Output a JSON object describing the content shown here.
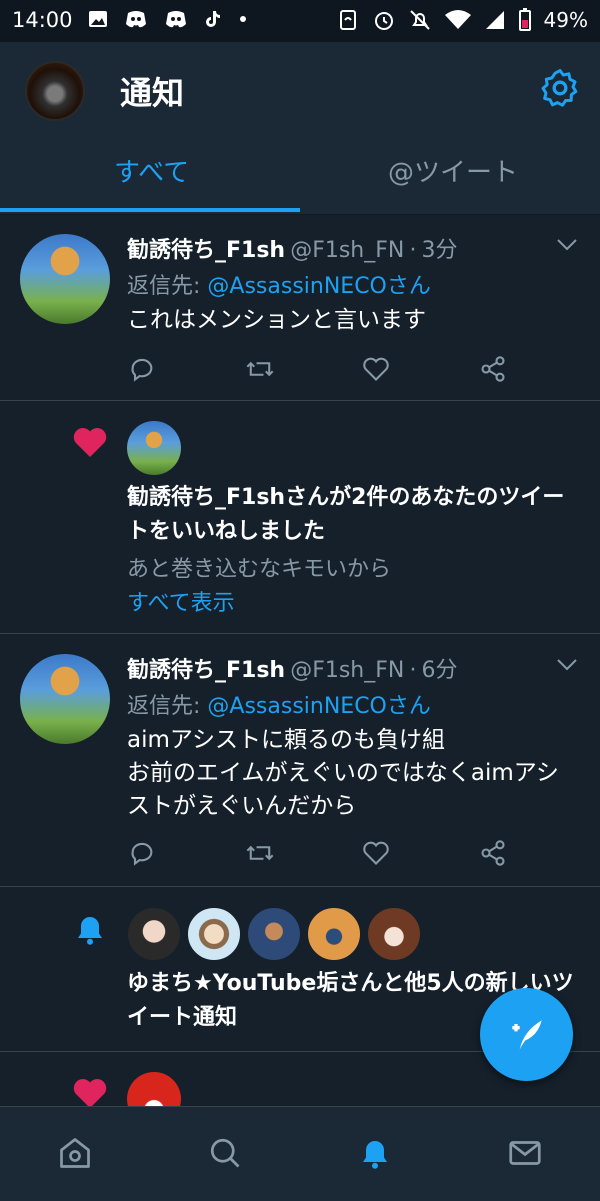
{
  "status_bar": {
    "time": "14:00",
    "battery": "49%",
    "left_icons": [
      "image-icon",
      "discord-icon",
      "discord-icon",
      "tiktok-icon",
      "dot-icon"
    ],
    "right_icons": [
      "nfc-icon",
      "alarm-icon",
      "mute-icon",
      "wifi-icon",
      "signal-icon",
      "battery-icon"
    ]
  },
  "header": {
    "title": "通知",
    "settings_icon": "gear-icon"
  },
  "tabs": [
    {
      "label": "すべて",
      "active": true
    },
    {
      "label": "@ツイート",
      "active": false
    }
  ],
  "feed": {
    "tweet1": {
      "display_name": "勧誘待ち_F1sh",
      "handle": "@F1sh_FN",
      "sep": "·",
      "time": "3分",
      "reply_label": "返信先: ",
      "reply_to": "@AssassinNECOさん",
      "text": "これはメンションと言います"
    },
    "like_notification": {
      "text": "勧誘待ち_F1shさんが2件のあなたのツイートをいいねしました",
      "preview": "あと巻き込むなキモいから",
      "show_all": "すべて表示"
    },
    "tweet2": {
      "display_name": "勧誘待ち_F1sh",
      "handle": "@F1sh_FN",
      "sep": "·",
      "time": "6分",
      "reply_label": "返信先: ",
      "reply_to": "@AssassinNECOさん",
      "text_line1": "aimアシストに頼るのも負け組",
      "text_line2": "お前のエイムがえぐいのではなくaimアシストがえぐいんだから"
    },
    "bell_notification": {
      "text": "ゆまち★YouTube垢さんと他5人の新しいツイート通知"
    }
  },
  "bottom_nav": [
    "home-icon",
    "search-icon",
    "notifications-icon",
    "messages-icon"
  ],
  "colors": {
    "background": "#15202b",
    "accent": "#1da1f2",
    "muted": "#8899a6",
    "like": "#e0245e"
  }
}
